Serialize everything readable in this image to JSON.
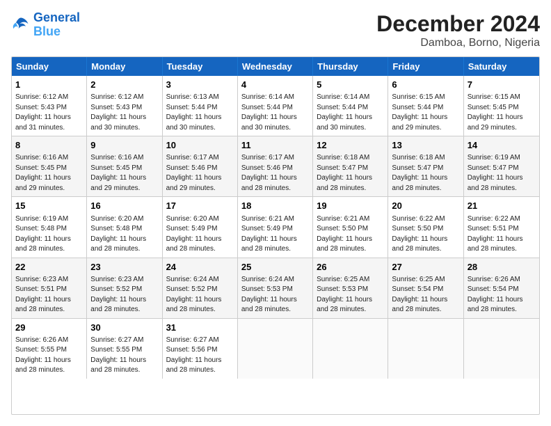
{
  "logo": {
    "line1": "General",
    "line2": "Blue"
  },
  "title": "December 2024",
  "subtitle": "Damboa, Borno, Nigeria",
  "header_days": [
    "Sunday",
    "Monday",
    "Tuesday",
    "Wednesday",
    "Thursday",
    "Friday",
    "Saturday"
  ],
  "rows": [
    {
      "shaded": false,
      "cells": [
        {
          "day": "1",
          "info": "Sunrise: 6:12 AM\nSunset: 5:43 PM\nDaylight: 11 hours\nand 31 minutes."
        },
        {
          "day": "2",
          "info": "Sunrise: 6:12 AM\nSunset: 5:43 PM\nDaylight: 11 hours\nand 30 minutes."
        },
        {
          "day": "3",
          "info": "Sunrise: 6:13 AM\nSunset: 5:44 PM\nDaylight: 11 hours\nand 30 minutes."
        },
        {
          "day": "4",
          "info": "Sunrise: 6:14 AM\nSunset: 5:44 PM\nDaylight: 11 hours\nand 30 minutes."
        },
        {
          "day": "5",
          "info": "Sunrise: 6:14 AM\nSunset: 5:44 PM\nDaylight: 11 hours\nand 30 minutes."
        },
        {
          "day": "6",
          "info": "Sunrise: 6:15 AM\nSunset: 5:44 PM\nDaylight: 11 hours\nand 29 minutes."
        },
        {
          "day": "7",
          "info": "Sunrise: 6:15 AM\nSunset: 5:45 PM\nDaylight: 11 hours\nand 29 minutes."
        }
      ]
    },
    {
      "shaded": true,
      "cells": [
        {
          "day": "8",
          "info": "Sunrise: 6:16 AM\nSunset: 5:45 PM\nDaylight: 11 hours\nand 29 minutes."
        },
        {
          "day": "9",
          "info": "Sunrise: 6:16 AM\nSunset: 5:45 PM\nDaylight: 11 hours\nand 29 minutes."
        },
        {
          "day": "10",
          "info": "Sunrise: 6:17 AM\nSunset: 5:46 PM\nDaylight: 11 hours\nand 29 minutes."
        },
        {
          "day": "11",
          "info": "Sunrise: 6:17 AM\nSunset: 5:46 PM\nDaylight: 11 hours\nand 28 minutes."
        },
        {
          "day": "12",
          "info": "Sunrise: 6:18 AM\nSunset: 5:47 PM\nDaylight: 11 hours\nand 28 minutes."
        },
        {
          "day": "13",
          "info": "Sunrise: 6:18 AM\nSunset: 5:47 PM\nDaylight: 11 hours\nand 28 minutes."
        },
        {
          "day": "14",
          "info": "Sunrise: 6:19 AM\nSunset: 5:47 PM\nDaylight: 11 hours\nand 28 minutes."
        }
      ]
    },
    {
      "shaded": false,
      "cells": [
        {
          "day": "15",
          "info": "Sunrise: 6:19 AM\nSunset: 5:48 PM\nDaylight: 11 hours\nand 28 minutes."
        },
        {
          "day": "16",
          "info": "Sunrise: 6:20 AM\nSunset: 5:48 PM\nDaylight: 11 hours\nand 28 minutes."
        },
        {
          "day": "17",
          "info": "Sunrise: 6:20 AM\nSunset: 5:49 PM\nDaylight: 11 hours\nand 28 minutes."
        },
        {
          "day": "18",
          "info": "Sunrise: 6:21 AM\nSunset: 5:49 PM\nDaylight: 11 hours\nand 28 minutes."
        },
        {
          "day": "19",
          "info": "Sunrise: 6:21 AM\nSunset: 5:50 PM\nDaylight: 11 hours\nand 28 minutes."
        },
        {
          "day": "20",
          "info": "Sunrise: 6:22 AM\nSunset: 5:50 PM\nDaylight: 11 hours\nand 28 minutes."
        },
        {
          "day": "21",
          "info": "Sunrise: 6:22 AM\nSunset: 5:51 PM\nDaylight: 11 hours\nand 28 minutes."
        }
      ]
    },
    {
      "shaded": true,
      "cells": [
        {
          "day": "22",
          "info": "Sunrise: 6:23 AM\nSunset: 5:51 PM\nDaylight: 11 hours\nand 28 minutes."
        },
        {
          "day": "23",
          "info": "Sunrise: 6:23 AM\nSunset: 5:52 PM\nDaylight: 11 hours\nand 28 minutes."
        },
        {
          "day": "24",
          "info": "Sunrise: 6:24 AM\nSunset: 5:52 PM\nDaylight: 11 hours\nand 28 minutes."
        },
        {
          "day": "25",
          "info": "Sunrise: 6:24 AM\nSunset: 5:53 PM\nDaylight: 11 hours\nand 28 minutes."
        },
        {
          "day": "26",
          "info": "Sunrise: 6:25 AM\nSunset: 5:53 PM\nDaylight: 11 hours\nand 28 minutes."
        },
        {
          "day": "27",
          "info": "Sunrise: 6:25 AM\nSunset: 5:54 PM\nDaylight: 11 hours\nand 28 minutes."
        },
        {
          "day": "28",
          "info": "Sunrise: 6:26 AM\nSunset: 5:54 PM\nDaylight: 11 hours\nand 28 minutes."
        }
      ]
    },
    {
      "shaded": false,
      "cells": [
        {
          "day": "29",
          "info": "Sunrise: 6:26 AM\nSunset: 5:55 PM\nDaylight: 11 hours\nand 28 minutes."
        },
        {
          "day": "30",
          "info": "Sunrise: 6:27 AM\nSunset: 5:55 PM\nDaylight: 11 hours\nand 28 minutes."
        },
        {
          "day": "31",
          "info": "Sunrise: 6:27 AM\nSunset: 5:56 PM\nDaylight: 11 hours\nand 28 minutes."
        },
        {
          "day": "",
          "info": ""
        },
        {
          "day": "",
          "info": ""
        },
        {
          "day": "",
          "info": ""
        },
        {
          "day": "",
          "info": ""
        }
      ]
    }
  ]
}
